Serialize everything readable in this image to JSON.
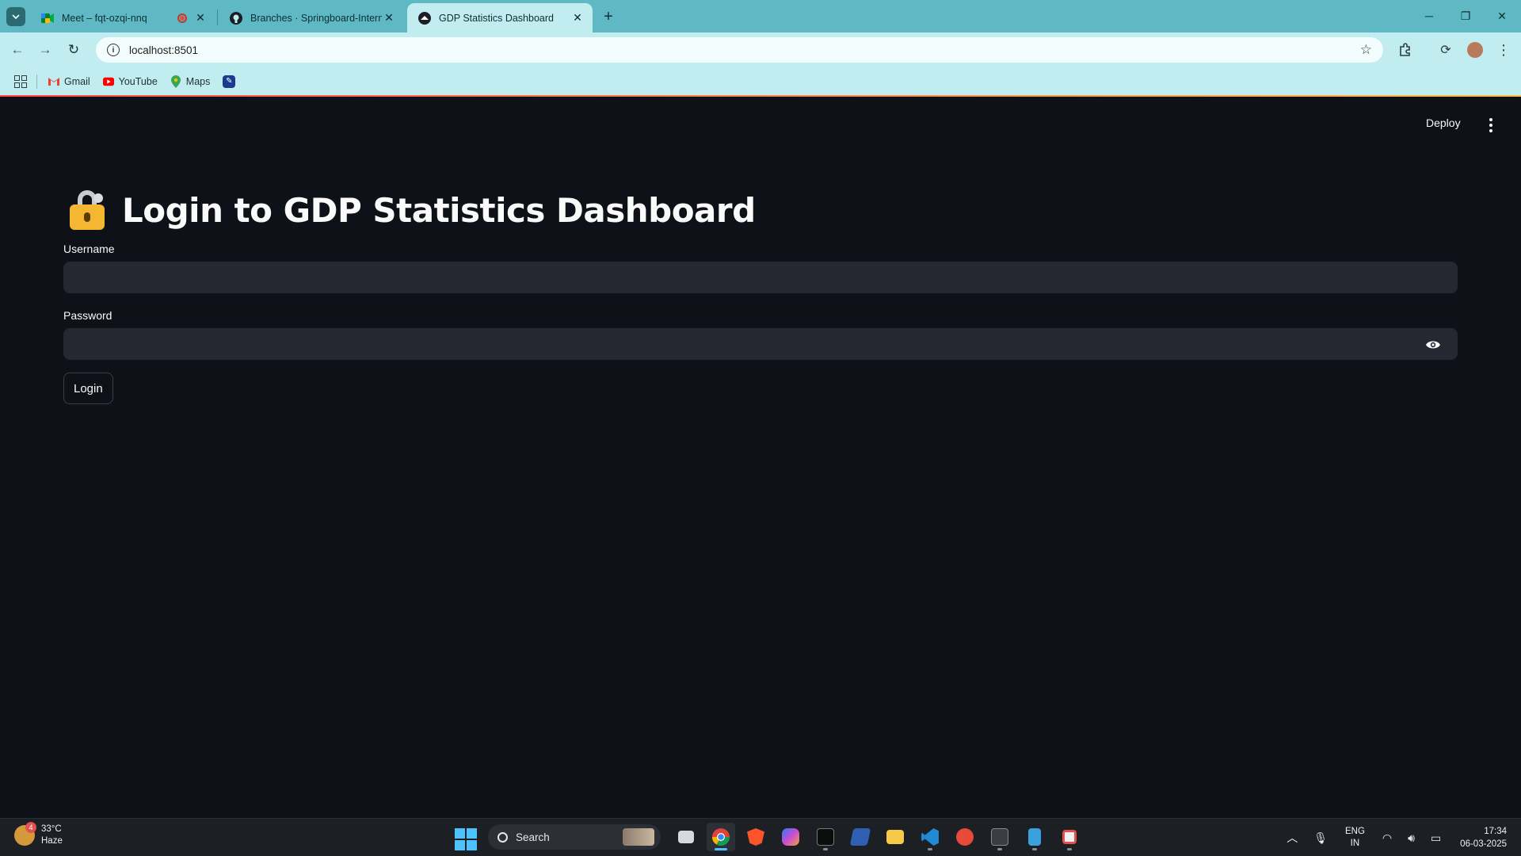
{
  "browser": {
    "tabs": [
      {
        "title": "Meet – fqt-ozqi-nnq",
        "active": false
      },
      {
        "title": "Branches · Springboard-Internsh",
        "active": false
      },
      {
        "title": "GDP Statistics Dashboard",
        "active": true
      }
    ],
    "url": "localhost:8501",
    "bookmarks": [
      {
        "label": "Gmail",
        "icon": "gmail-icon"
      },
      {
        "label": "YouTube",
        "icon": "youtube-icon"
      },
      {
        "label": "Maps",
        "icon": "maps-icon"
      }
    ]
  },
  "app": {
    "deploy_label": "Deploy",
    "title": "Login to GDP Statistics Dashboard",
    "title_icon": "lock-with-key-icon",
    "username_label": "Username",
    "username_value": "",
    "password_label": "Password",
    "password_value": "",
    "login_label": "Login"
  },
  "taskbar": {
    "weather_temp": "33°C",
    "weather_desc": "Haze",
    "weather_badge": "4",
    "search_label": "Search",
    "lang_top": "ENG",
    "lang_bottom": "IN",
    "time": "17:34",
    "date": "06-03-2025"
  },
  "colors": {
    "app_background": "#0e1117",
    "input_background": "#262730",
    "chrome_accent": "#5eb9c4",
    "chrome_toolbar": "#c1ecf0"
  }
}
